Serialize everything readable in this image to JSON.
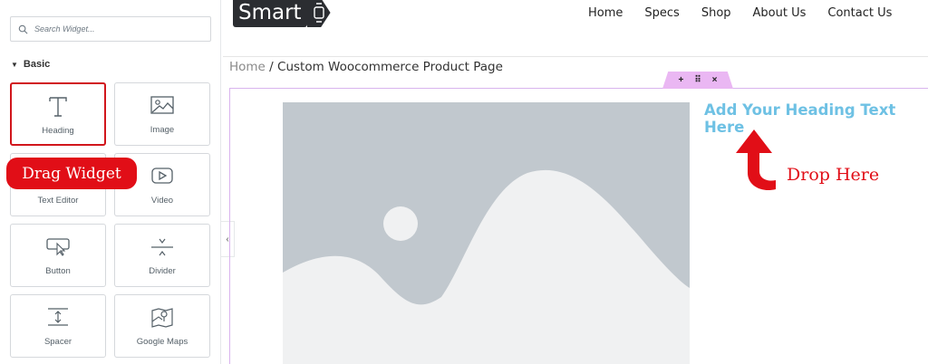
{
  "sidebar": {
    "search_placeholder": "Search Widget...",
    "category": "Basic",
    "widgets": [
      {
        "label": "Heading",
        "icon": "heading-icon"
      },
      {
        "label": "Image",
        "icon": "image-icon"
      },
      {
        "label": "Text Editor",
        "icon": "text-editor-icon"
      },
      {
        "label": "Video",
        "icon": "video-icon"
      },
      {
        "label": "Button",
        "icon": "button-icon"
      },
      {
        "label": "Divider",
        "icon": "divider-icon"
      },
      {
        "label": "Spacer",
        "icon": "spacer-icon"
      },
      {
        "label": "Google Maps",
        "icon": "google-maps-icon"
      }
    ],
    "drag_badge": "Drag Widget"
  },
  "header": {
    "logo_text": "Smart",
    "nav": [
      "Home",
      "Specs",
      "Shop",
      "About Us",
      "Contact Us"
    ]
  },
  "breadcrumb": {
    "home": "Home",
    "separator": "/",
    "current": "Custom Woocommerce Product Page"
  },
  "canvas": {
    "section_controls": [
      "+",
      "⠿",
      "×"
    ],
    "heading_placeholder": "Add Your Heading Text Here",
    "drop_label": "Drop Here"
  },
  "colors": {
    "accent_red": "#e10e17",
    "heading_blue": "#6ec1e4",
    "section_outline": "#d9b4ee"
  }
}
